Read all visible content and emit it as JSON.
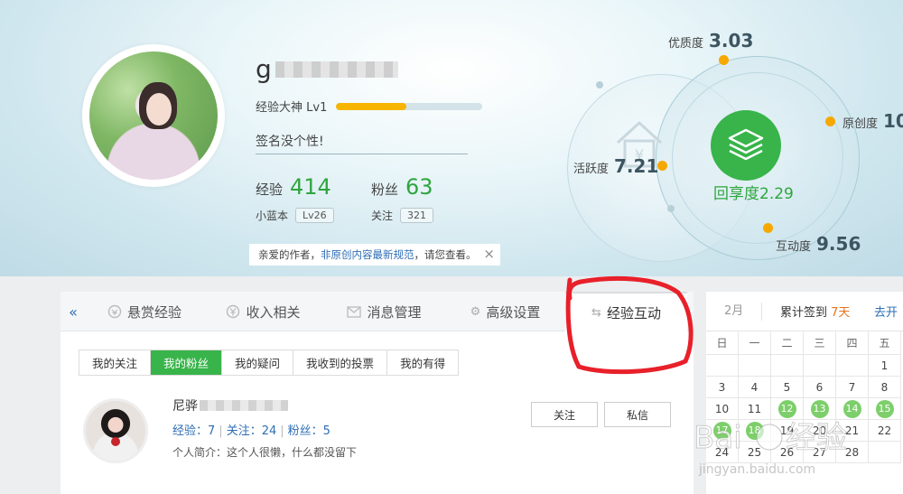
{
  "profile": {
    "name_visible": "g",
    "level_label": "经验大神 Lv1",
    "level_progress": 0.48,
    "signature": "签名没个性!",
    "exp_label": "经验",
    "exp_value": "414",
    "fans_label": "粉丝",
    "fans_value": "63",
    "badge_label": "小蓝本",
    "badge_value": "Lv26",
    "follow_label": "关注",
    "follow_value": "321"
  },
  "notice": {
    "prefix": "亲爱的作者，",
    "link": "非原创内容最新规范",
    "suffix": "，请您查看。",
    "close": "×"
  },
  "radar": {
    "quality_label": "优质度",
    "quality_value": "3.03",
    "original_label": "原创度",
    "original_value": "10",
    "activity_label": "活跃度",
    "activity_value": "7.21",
    "interaction_label": "互动度",
    "interaction_value": "9.56",
    "share_label": "回享度",
    "share_value": "2.29"
  },
  "tabs": {
    "back": "«",
    "items": [
      {
        "label": "悬赏经验",
        "icon": "coin-icon"
      },
      {
        "label": "收入相关",
        "icon": "yen-icon"
      },
      {
        "label": "消息管理",
        "icon": "mail-icon"
      },
      {
        "label": "高级设置",
        "icon": "gear-icon"
      },
      {
        "label": "经验互动",
        "icon": "swap-icon"
      }
    ],
    "active_index": 4
  },
  "subtabs": [
    "我的关注",
    "我的粉丝",
    "我的疑问",
    "我收到的投票",
    "我的有得"
  ],
  "fan": {
    "name_visible": "尼骅",
    "exp_label": "经验：",
    "exp_value": "7",
    "follow_label": "关注：",
    "follow_value": "24",
    "fans_label": "粉丝：",
    "fans_value": "5",
    "bio": "个人简介：这个人很懒，什么都没留下",
    "follow_button": "关注",
    "message_button": "私信"
  },
  "calendar": {
    "month": "2月",
    "total_prefix": "累计签到",
    "total_value": "7天",
    "more": "去开",
    "weekdays": [
      "日",
      "一",
      "二",
      "三",
      "四",
      "五"
    ],
    "rows": [
      [
        "",
        "",
        "",
        "",
        "",
        "1"
      ],
      [
        "3",
        "4",
        "5",
        "6",
        "7",
        "8"
      ],
      [
        "10",
        "11",
        "12",
        "13",
        "14",
        "15"
      ],
      [
        "17",
        "18",
        "19",
        "20",
        "21",
        "22"
      ],
      [
        "24",
        "25",
        "26",
        "27",
        "28",
        ""
      ]
    ],
    "signed": [
      "12",
      "13",
      "14",
      "15",
      "17",
      "18"
    ]
  },
  "colors": {
    "accent_green": "#38b44a",
    "stat_green": "#2fa53f",
    "dot_orange": "#f6a800",
    "link_blue": "#2e6eb5",
    "annotation_red": "#e8202a"
  }
}
